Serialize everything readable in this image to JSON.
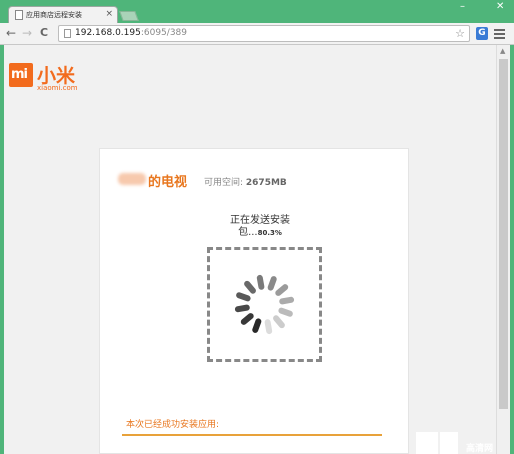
{
  "browser": {
    "tab_title": "应用商店远程安装",
    "tab_close": "×",
    "window_minimize": "–",
    "window_close": "✕",
    "back": "←",
    "forward": "→",
    "reload": "C",
    "url_host": "192.168.0.195",
    "url_path": ":6095/389",
    "star": "☆",
    "extension_label": "G"
  },
  "site": {
    "logo_mark": "mi",
    "brand_name": "小米",
    "domain_label": "xiaomi.com"
  },
  "device": {
    "name": "的电视",
    "space_label": "可用空间: ",
    "space_value": "2675MB"
  },
  "install": {
    "status_text": "正在发送安装包...",
    "status_line1": "正在发送安装",
    "status_line2": "包...",
    "percent": "80.3%",
    "progress": 0.803,
    "success_text": "本次已经成功安装应用:"
  },
  "watermark": {
    "text": "高清网"
  },
  "colors": {
    "accent": "#f26b1d",
    "frame": "#4fb57a",
    "title_orange": "#e8771f"
  }
}
